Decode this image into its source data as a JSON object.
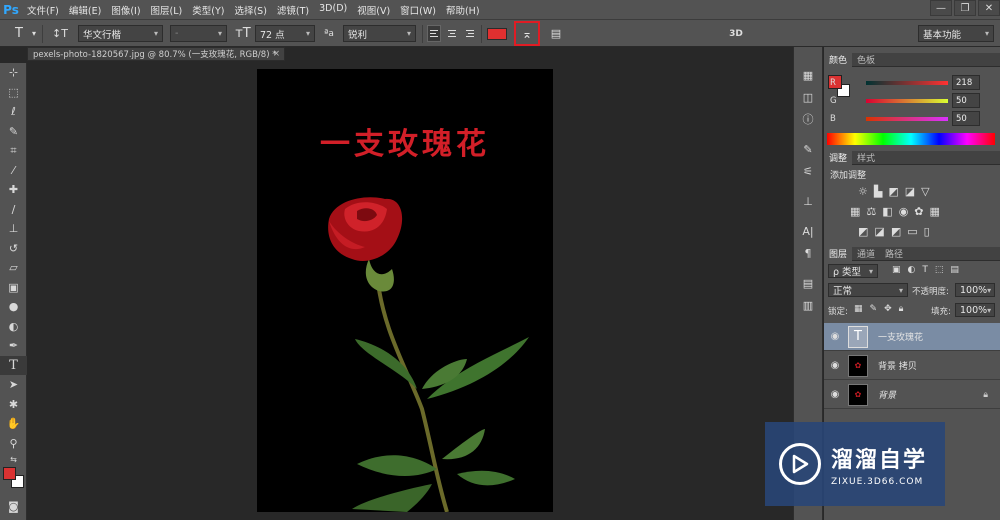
{
  "app": {
    "logo": "Ps"
  },
  "menu": [
    "文件(F)",
    "编辑(E)",
    "图像(I)",
    "图层(L)",
    "类型(Y)",
    "选择(S)",
    "滤镜(T)",
    "3D(D)",
    "视图(V)",
    "窗口(W)",
    "帮助(H)"
  ],
  "window_controls": {
    "minimize": "—",
    "restore": "❐",
    "close": "✕"
  },
  "options": {
    "font_family": "华文行楷",
    "font_style": "-",
    "font_size": "72 点",
    "aa_label": "ªa",
    "antialias": "锐利",
    "text_color": "#e03030",
    "mode_3d": "3D",
    "workspace": "基本功能"
  },
  "document": {
    "tab_title": "pexels-photo-1820567.jpg @ 80.7% (一支玫瑰花, RGB/8) *",
    "close": "×",
    "canvas_text": "一支玫瑰花"
  },
  "panels": {
    "color_tabs": [
      "颜色",
      "色板"
    ],
    "color": {
      "r_label": "R",
      "g_label": "G",
      "b_label": "B",
      "r": "218",
      "g": "50",
      "b": "50",
      "fg": "#da3232",
      "bg": "#ffffff"
    },
    "adjust_tabs": [
      "调整",
      "样式"
    ],
    "adjust_title": "添加调整",
    "layer_tabs": [
      "图层",
      "通道",
      "路径"
    ],
    "layer_filter": "ρ 类型",
    "blend_mode": "正常",
    "opacity_label": "不透明度:",
    "opacity": "100%",
    "lock_label": "锁定:",
    "fill_label": "填充:",
    "fill": "100%",
    "layers": [
      {
        "name": "一支玫瑰花",
        "thumb": "T"
      },
      {
        "name": "背景 拷贝",
        "thumb": ""
      },
      {
        "name": "背景",
        "thumb": ""
      }
    ]
  },
  "watermark": {
    "title": "溜溜自学",
    "url": "ZIXUE.3D66.COM"
  }
}
